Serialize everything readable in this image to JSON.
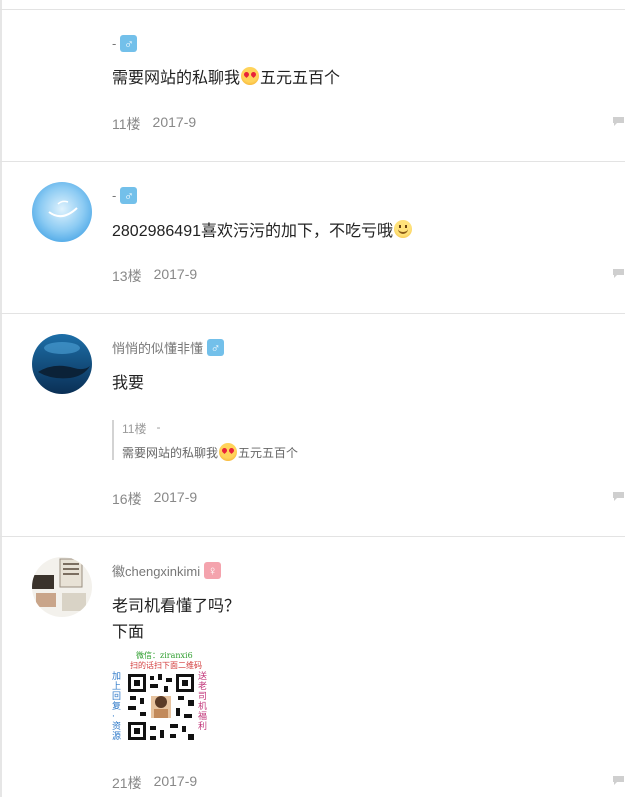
{
  "posts": [
    {
      "username": "-",
      "gender": "male",
      "gender_symbol": "♂",
      "content_before": "需要网站的私聊我",
      "emoji": "star-struck-emoji",
      "content_after": "五元五百个",
      "floor": "11楼",
      "date": "2017-9"
    },
    {
      "username": "-",
      "gender": "male",
      "gender_symbol": "♂",
      "content_before": "2802986491喜欢污污的加下，不吃亏哦",
      "emoji": "smile-emoji",
      "floor": "13楼",
      "date": "2017-9"
    },
    {
      "username": "悄悄的似懂非懂",
      "gender": "male",
      "gender_symbol": "♂",
      "content": "我要",
      "quote": {
        "floor": "11楼",
        "user": "-",
        "text_before": "需要网站的私聊我",
        "emoji": "star-struck-emoji",
        "text_after": "五元五百个"
      },
      "floor": "16楼",
      "date": "2017-9"
    },
    {
      "username": "徽chengxinkimi",
      "gender": "female",
      "gender_symbol": "♀",
      "content_line1": "老司机看懂了吗？",
      "content_line2": "下面",
      "qr_image": {
        "top_line1": "微信：ziranxi6",
        "top_line2": "扫的话扫下面二维码",
        "left_text": "加上回复·资源",
        "right_text": "送老司机福利"
      },
      "floor": "21楼",
      "date": "2017-9"
    }
  ],
  "colors": {
    "male_badge": "#73c0ea",
    "female_badge": "#f4a3ad",
    "meta_text": "#888888"
  }
}
